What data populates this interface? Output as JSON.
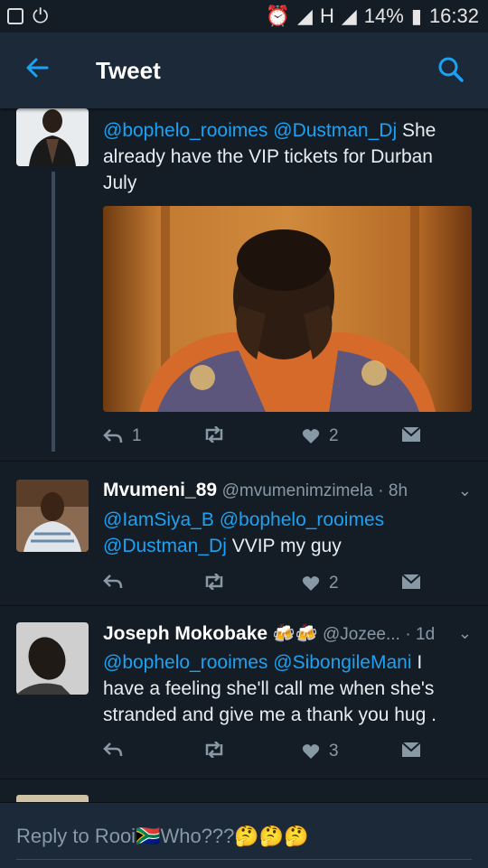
{
  "status": {
    "battery": "14%",
    "time": "16:32",
    "network": "H"
  },
  "header": {
    "title": "Tweet",
    "back_icon": "arrow-left-icon",
    "search_icon": "search-icon",
    "accent": "#1da1f2"
  },
  "tweets": [
    {
      "body_mentions": "@bophelo_rooimes @Dustman_Dj",
      "body_rest": " She already have the VIP tickets for Durban July",
      "reply_count": "1",
      "like_count": "2"
    },
    {
      "name": "Mvumeni_89",
      "handle": "@mvumenimzimela",
      "time": "· 8h",
      "body_mentions": "@IamSiya_B @bophelo_rooimes @Dustman_Dj",
      "body_rest": " VVIP my guy",
      "like_count": "2"
    },
    {
      "name": "Joseph Mokobake",
      "emoji": "🍻🍻",
      "handle": "@Jozee...",
      "time": "· 1d",
      "body_mentions": "@bophelo_rooimes @SibongileMani",
      "body_rest": " I have a feeling she'll call me when she's stranded and give me a thank you hug .",
      "like_count": "3"
    }
  ],
  "reply_box": {
    "placeholder": "Reply to Rooi🇿🇦Who???🤔🤔🤔"
  }
}
